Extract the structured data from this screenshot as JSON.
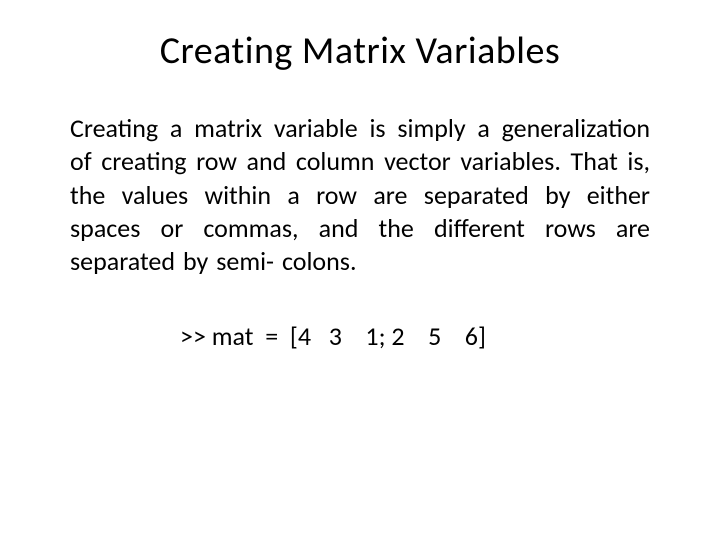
{
  "title": "Creating Matrix Variables",
  "paragraph": "Creating  a matrix  variable  is simply  a generalization of  creating  row  and column vector variables.  That is, the  values within  a row  are separated   by either   spaces   or commas,    and  the  different  rows  are separated   by  semi- colons.",
  "code": ">> mat  =  [4   3    1; 2    5    6]"
}
